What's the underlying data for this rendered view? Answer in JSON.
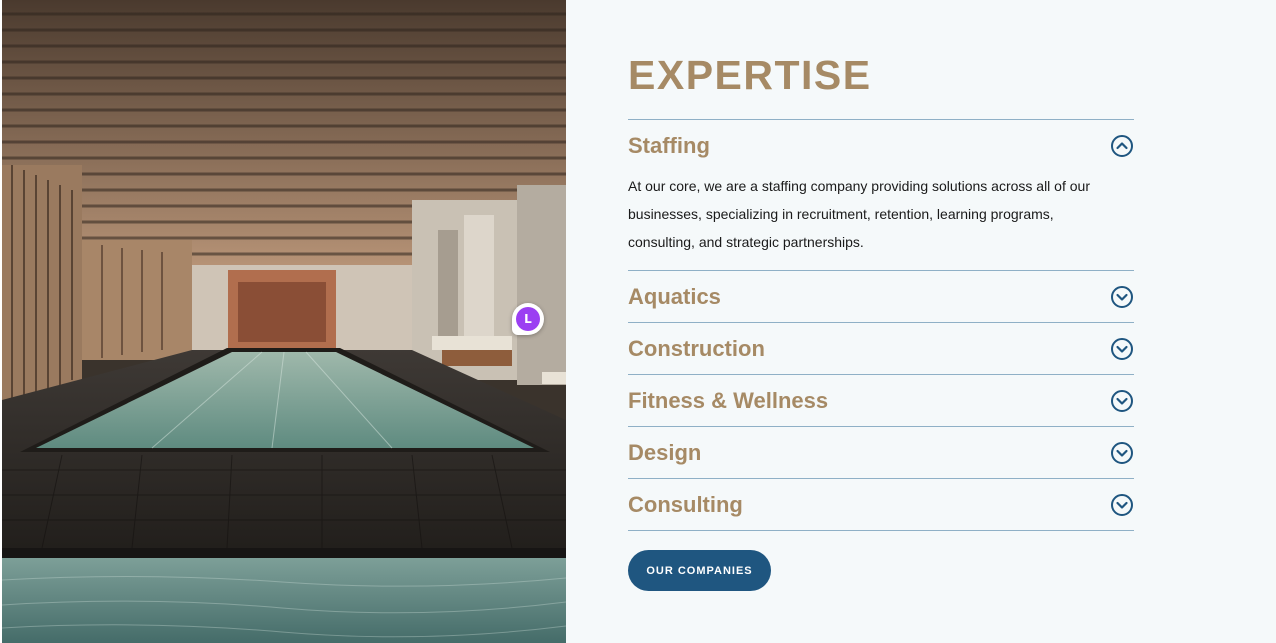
{
  "photo": {
    "alt_icon": "indoor-pool-photo"
  },
  "chat": {
    "initial": "L",
    "icon": "chat-avatar-icon",
    "color": "#9b3ff2"
  },
  "section": {
    "heading": "EXPERTISE",
    "items": [
      {
        "title": "Staffing",
        "open": true,
        "icon": "chevron-up-circle-icon",
        "body": "At our core, we are a staffing company providing solutions across all of our businesses, specializing in recruitment, retention, learning programs, consulting, and strategic partnerships."
      },
      {
        "title": "Aquatics",
        "open": false,
        "icon": "chevron-down-circle-icon"
      },
      {
        "title": "Construction",
        "open": false,
        "icon": "chevron-down-circle-icon"
      },
      {
        "title": "Fitness & Wellness",
        "open": false,
        "icon": "chevron-down-circle-icon"
      },
      {
        "title": "Design",
        "open": false,
        "icon": "chevron-down-circle-icon"
      },
      {
        "title": "Consulting",
        "open": false,
        "icon": "chevron-down-circle-icon"
      }
    ],
    "cta_label": "OUR COMPANIES"
  },
  "colors": {
    "gold": "#a68a65",
    "navy": "#1f5680",
    "divider": "#8fb0c6",
    "panel_bg": "#f5f9fa"
  }
}
